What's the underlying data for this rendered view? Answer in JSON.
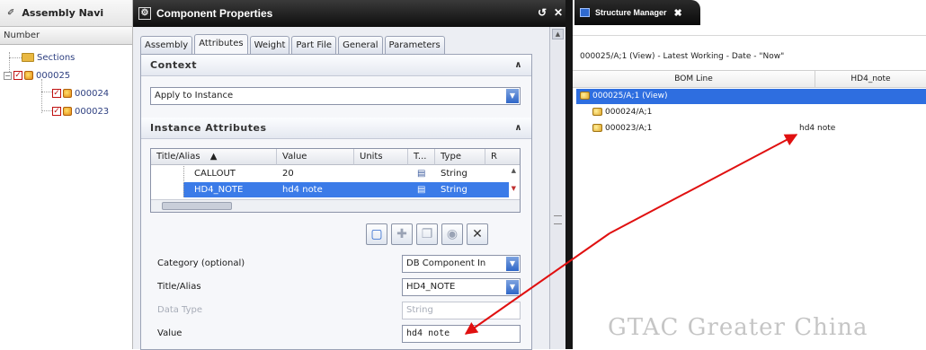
{
  "navigator": {
    "title": "Assembly Navi",
    "column_header": "Number",
    "items": [
      {
        "label": "Sections"
      },
      {
        "label": "000025"
      },
      {
        "label": "000024"
      },
      {
        "label": "000023"
      }
    ]
  },
  "dialog": {
    "title": "Component Properties",
    "tabs": [
      {
        "label": "Assembly"
      },
      {
        "label": "Attributes"
      },
      {
        "label": "Weight"
      },
      {
        "label": "Part File"
      },
      {
        "label": "General"
      },
      {
        "label": "Parameters"
      }
    ],
    "context": {
      "header": "Context",
      "apply_to_value": "Apply to Instance"
    },
    "instance_attributes": {
      "header": "Instance Attributes",
      "columns": [
        "Title/Alias",
        "Value",
        "Units",
        "T...",
        "Type",
        "R"
      ],
      "sort_indicator": "▲",
      "rows": [
        {
          "title": "CALLOUT",
          "value": "20",
          "type": "String"
        },
        {
          "title": "HD4_NOTE",
          "value": "hd4 note",
          "type": "String"
        }
      ]
    },
    "form": {
      "category_label": "Category (optional)",
      "category_value": "DB Component In",
      "title_label": "Title/Alias",
      "title_value": "HD4_NOTE",
      "data_type_label": "Data Type",
      "data_type_value": "String",
      "value_label": "Value",
      "value_value": "hd4 note"
    }
  },
  "structure_manager": {
    "tab_label": "Structure Manager",
    "status": "000025/A;1 (View) - Latest Working - Date - \"Now\"",
    "columns": [
      "BOM Line",
      "HD4_note"
    ],
    "rows": [
      {
        "bom": "000025/A;1 (View)",
        "note": ""
      },
      {
        "bom": "000024/A;1",
        "note": ""
      },
      {
        "bom": "000023/A;1",
        "note": "hd4 note"
      }
    ]
  },
  "watermark": "GTAC Greater China",
  "colors": {
    "annotation_arrow": "#e01010",
    "selection": "#3b7be8",
    "title_bar": "#111111"
  }
}
